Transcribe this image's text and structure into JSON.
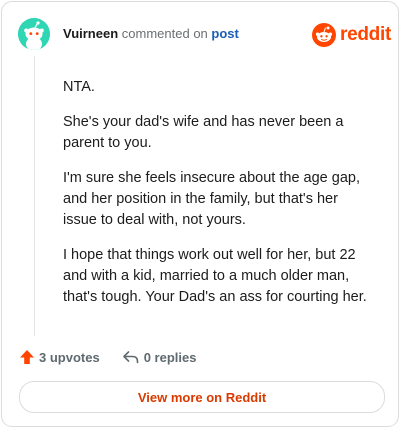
{
  "comment": {
    "author": "Vuirneen",
    "action_text": "commented on",
    "post_link": "post",
    "paragraphs": [
      "NTA.",
      "She's your dad's wife and has never been a parent to you.",
      "I'm sure she feels insecure about the age gap, and her position in the family, but that's her issue to deal with, not yours.",
      "I hope that things work out well for her, but 22 and with a kid, married to a much older man, that's tough. Your Dad's an ass for courting her."
    ]
  },
  "brand": {
    "wordmark": "reddit",
    "color": "#ff4500"
  },
  "actions": {
    "upvotes": "3 upvotes",
    "replies": "0 replies",
    "upvote_icon": "upvote-arrow-icon",
    "reply_icon": "reply-arrow-icon"
  },
  "footer": {
    "view_more_label": "View more on Reddit"
  },
  "colors": {
    "accent": "#ff4500",
    "link": "#1b5fb8",
    "avatar_bg": "#2fd6b3",
    "muted_text": "#5f6a70",
    "button_text": "#d93a00"
  }
}
